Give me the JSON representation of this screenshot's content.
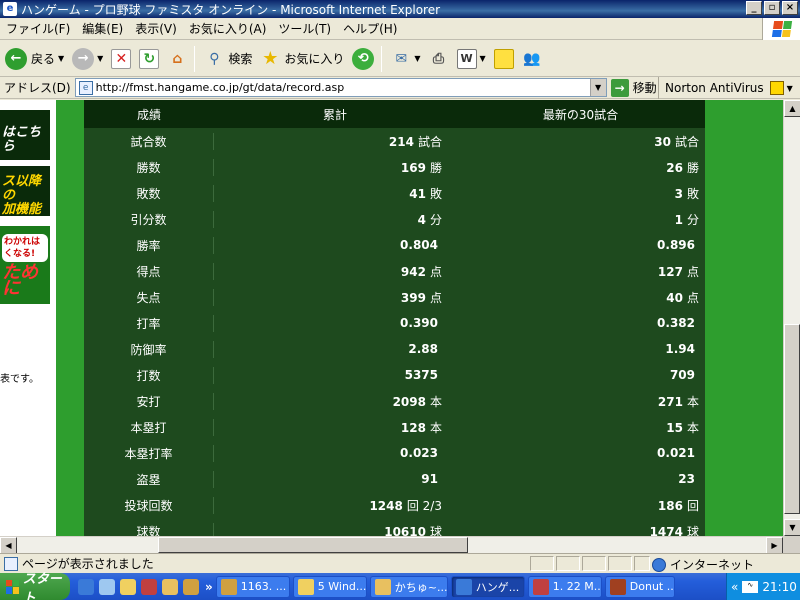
{
  "window": {
    "title": "ハンゲーム - プロ野球 ファミスタ オンライン - Microsoft Internet Explorer"
  },
  "menu": [
    "ファイル(F)",
    "編集(E)",
    "表示(V)",
    "お気に入り(A)",
    "ツール(T)",
    "ヘルプ(H)"
  ],
  "toolbar": {
    "back_label": "戻る",
    "search_label": "検索",
    "favorites_label": "お気に入り"
  },
  "address": {
    "label": "アドレス(D)",
    "url": "http://fmst.hangame.co.jp/gt/data/record.asp",
    "go_label": "移動",
    "norton_label": "Norton AntiVirus"
  },
  "sidebar": {
    "banner1": "はこちら",
    "banner2_line1": "ス以降の",
    "banner2_line2": "加機能",
    "banner3_note": "わかれは\nくなる!",
    "banner3_big": "ために",
    "note": "表です。"
  },
  "record": {
    "headers": [
      "成績",
      "累計",
      "最新の30試合"
    ],
    "rows": [
      {
        "label": "試合数",
        "total": "214",
        "total_unit": "試合",
        "recent": "30",
        "recent_unit": "試合"
      },
      {
        "label": "勝数",
        "total": "169",
        "total_unit": "勝",
        "recent": "26",
        "recent_unit": "勝"
      },
      {
        "label": "敗数",
        "total": "41",
        "total_unit": "敗",
        "recent": "3",
        "recent_unit": "敗"
      },
      {
        "label": "引分数",
        "total": "4",
        "total_unit": "分",
        "recent": "1",
        "recent_unit": "分"
      },
      {
        "label": "勝率",
        "total": "0.804",
        "total_unit": "",
        "recent": "0.896",
        "recent_unit": ""
      },
      {
        "label": "得点",
        "total": "942",
        "total_unit": "点",
        "recent": "127",
        "recent_unit": "点"
      },
      {
        "label": "失点",
        "total": "399",
        "total_unit": "点",
        "recent": "40",
        "recent_unit": "点"
      },
      {
        "label": "打率",
        "total": "0.390",
        "total_unit": "",
        "recent": "0.382",
        "recent_unit": ""
      },
      {
        "label": "防御率",
        "total": "2.88",
        "total_unit": "",
        "recent": "1.94",
        "recent_unit": ""
      },
      {
        "label": "打数",
        "total": "5375",
        "total_unit": "",
        "recent": "709",
        "recent_unit": ""
      },
      {
        "label": "安打",
        "total": "2098",
        "total_unit": "本",
        "recent": "271",
        "recent_unit": "本"
      },
      {
        "label": "本塁打",
        "total": "128",
        "total_unit": "本",
        "recent": "15",
        "recent_unit": "本"
      },
      {
        "label": "本塁打率",
        "total": "0.023",
        "total_unit": "",
        "recent": "0.021",
        "recent_unit": ""
      },
      {
        "label": "盗塁",
        "total": "91",
        "total_unit": "",
        "recent": "23",
        "recent_unit": ""
      },
      {
        "label": "投球回数",
        "total": "1248",
        "total_unit": "回 2/3",
        "recent": "186",
        "recent_unit": "回"
      },
      {
        "label": "球数",
        "total": "10610",
        "total_unit": "球",
        "recent": "1474",
        "recent_unit": "球"
      }
    ]
  },
  "status": {
    "text": "ページが表示されました",
    "zone": "インターネット"
  },
  "taskbar": {
    "start_label": "スタート",
    "chevron": "»",
    "tasks": [
      "1163. ...",
      "5 Wind...",
      "かちゅ~...",
      "ハンゲ...",
      "1. 22 M...",
      "Donut ..."
    ],
    "clock": "21:10"
  }
}
